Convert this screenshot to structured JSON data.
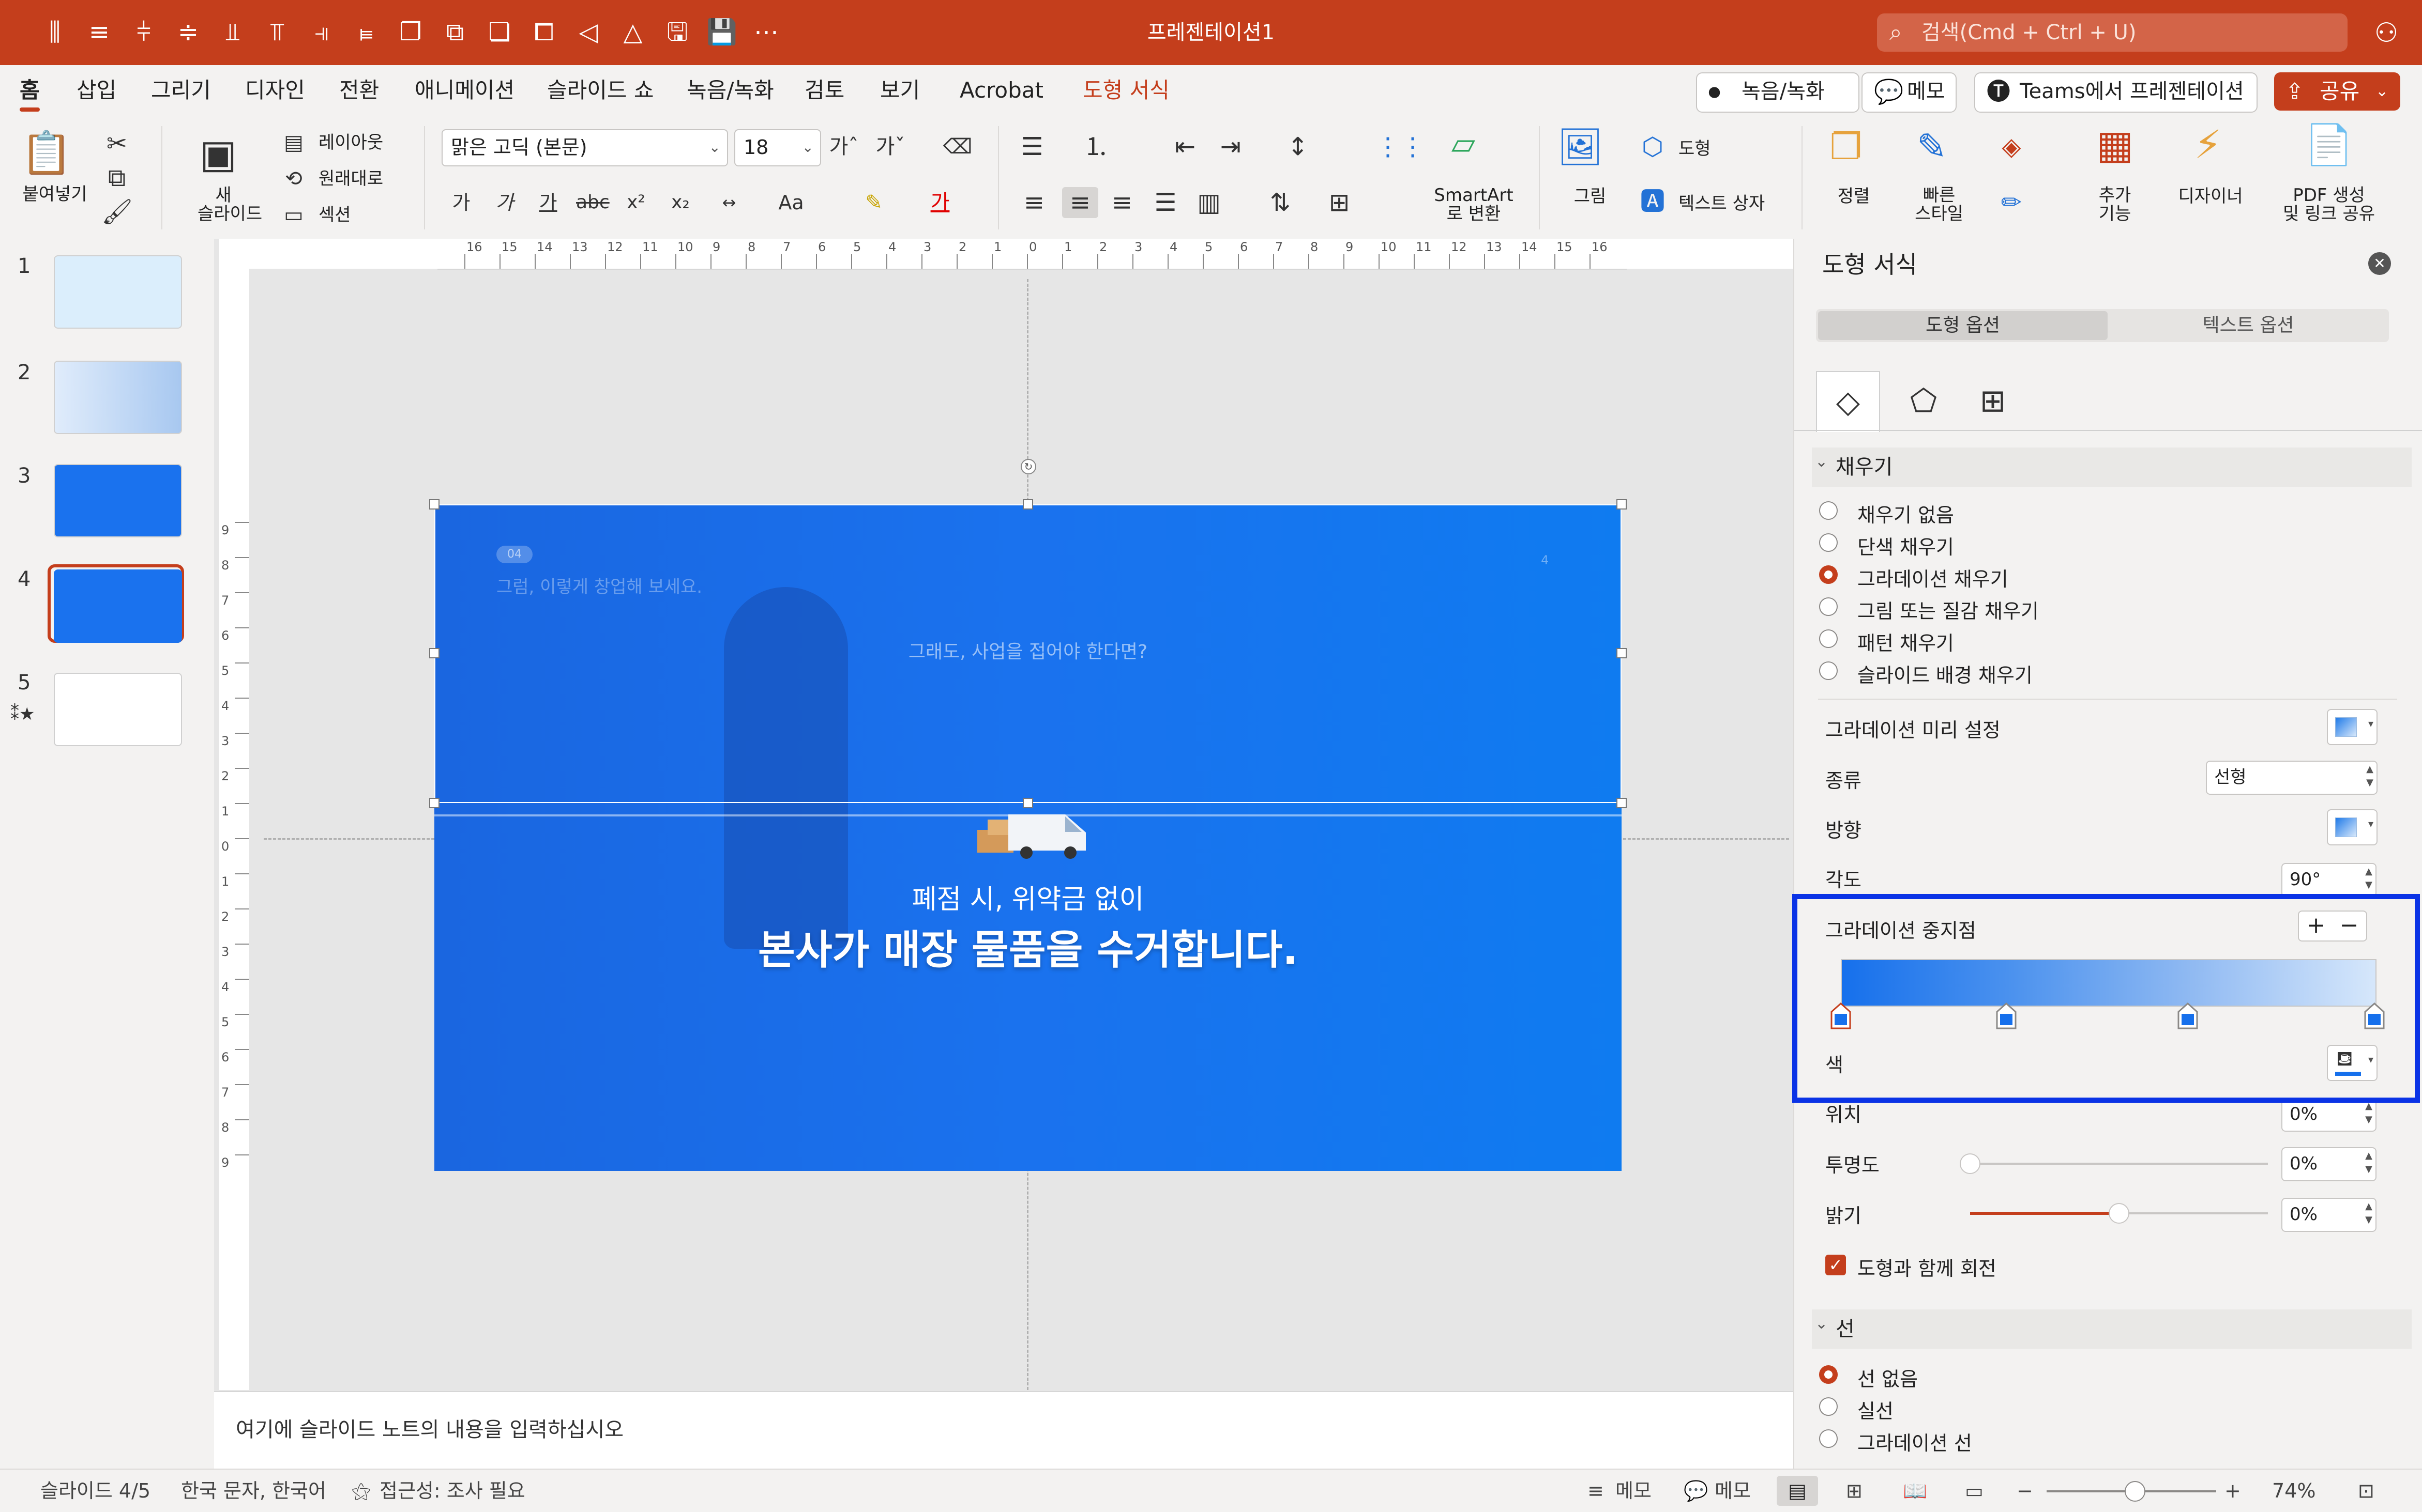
{
  "window": {
    "title": "프레젠테이션1"
  },
  "search": {
    "placeholder": "검색(Cmd + Ctrl + U)"
  },
  "menu": {
    "tabs": [
      "홈",
      "삽입",
      "그리기",
      "디자인",
      "전환",
      "애니메이션",
      "슬라이드 쇼",
      "녹음/녹화",
      "검토",
      "보기",
      "Acrobat",
      "도형 서식"
    ],
    "record_btn": "녹음/녹화",
    "memo_btn": "메모",
    "teams_btn": "Teams에서 프레젠테이션",
    "share_btn": "공유"
  },
  "ribbon": {
    "paste": "붙여넣기",
    "new_slide_line1": "새",
    "new_slide_line2": "슬라이드",
    "layout": "레이아웃",
    "reset": "원래대로",
    "section": "섹션",
    "font_name": "맑은 고딕 (본문)",
    "font_size": "18",
    "picture": "그림",
    "shape": "도형",
    "textbox": "텍스트 상자",
    "smartart_line1": "SmartArt",
    "smartart_line2": "로 변환",
    "arrange": "정렬",
    "quick_styles_line1": "빠른",
    "quick_styles_line2": "스타일",
    "addins_line1": "추가",
    "addins_line2": "기능",
    "designer": "디자이너",
    "pdf_line1": "PDF 생성",
    "pdf_line2": "및 링크 공유"
  },
  "slides": {
    "numbers": [
      "1",
      "2",
      "3",
      "4",
      "5"
    ],
    "selected": 4
  },
  "slide": {
    "badge": "04",
    "header_text": "그럼, 이렇게 창업해 보세요.",
    "page_number": "4",
    "question": "그래도, 사업을 접어야 한다면?",
    "sub_line": "폐점 시, 위약금 없이",
    "main_line": "본사가 매장 물품을 수거합니다."
  },
  "notes": {
    "placeholder": "여기에 슬라이드 노트의 내용을 입력하십시오"
  },
  "pane": {
    "title": "도형 서식",
    "tab_shape_options": "도형 옵션",
    "tab_text_options": "텍스트 옵션",
    "fill_section": "채우기",
    "fill_options": [
      "채우기 없음",
      "단색 채우기",
      "그라데이션 채우기",
      "그림 또는 질감 채우기",
      "패턴 채우기",
      "슬라이드 배경 채우기"
    ],
    "fill_selected": 2,
    "preset_label": "그라데이션 미리 설정",
    "type_label": "종류",
    "type_value": "선형",
    "direction_label": "방향",
    "angle_label": "각도",
    "angle_value": "90°",
    "stops_label": "그라데이션 중지점",
    "stop_positions_pct": [
      0,
      31,
      65,
      100
    ],
    "color_label": "색",
    "position_label": "위치",
    "position_value": "0%",
    "transparency_label": "투명도",
    "transparency_value": "0%",
    "transparency_level": 0,
    "brightness_label": "밝기",
    "brightness_value": "0%",
    "brightness_level": 0.5,
    "rotate_with_shape": "도형과 함께 회전",
    "line_section": "선",
    "line_options": [
      "선 없음",
      "실선",
      "그라데이션 선"
    ],
    "line_selected": 0
  },
  "status": {
    "slide_counter": "슬라이드 4/5",
    "language": "한국 문자, 한국어",
    "accessibility": "접근성: 조사 필요",
    "notes_btn": "메모",
    "comments_btn": "메모",
    "zoom": "74%",
    "zoom_level": 0.52
  },
  "colors": {
    "accent": "#c43e1c",
    "highlight_box": "#0a33e6",
    "slide_blue": "#1a72ee"
  }
}
